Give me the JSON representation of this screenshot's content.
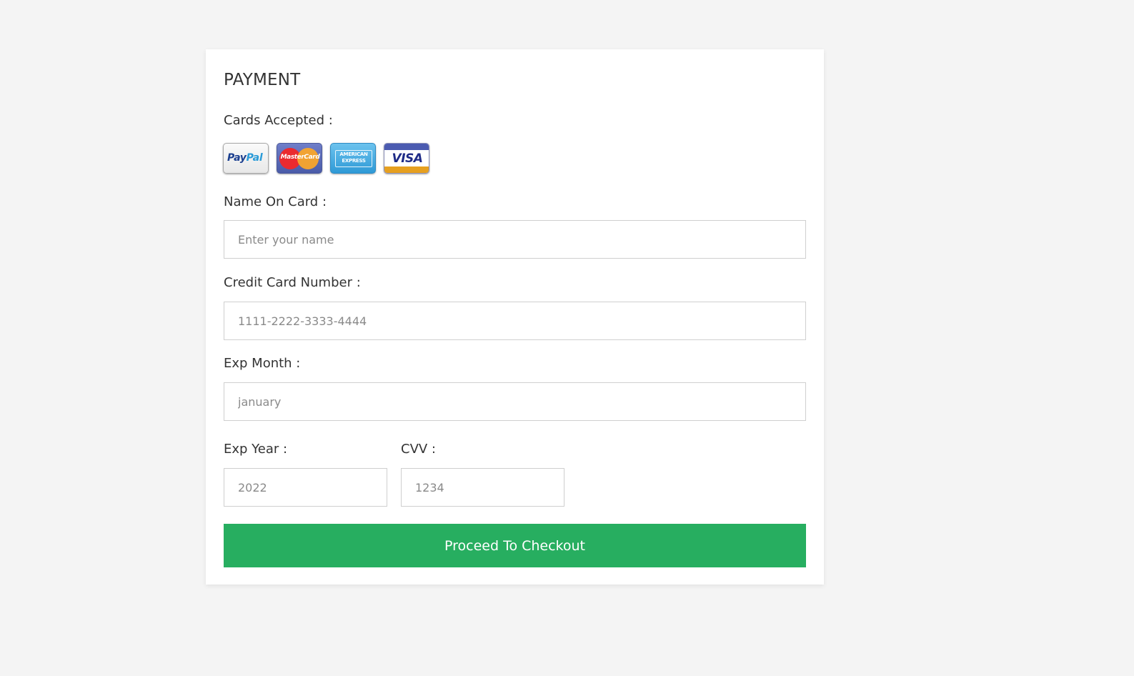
{
  "payment": {
    "title": "PAYMENT",
    "cards_label": "Cards Accepted :",
    "cards": [
      {
        "name": "PayPal",
        "icon": "paypal-icon"
      },
      {
        "name": "MasterCard",
        "icon": "mastercard-icon"
      },
      {
        "name": "AMERICAN EXPRESS",
        "icon": "amex-icon"
      },
      {
        "name": "VISA",
        "icon": "visa-icon"
      }
    ],
    "name_label": "Name On Card :",
    "name_placeholder": "Enter your name",
    "card_number_label": "Credit Card Number :",
    "card_number_placeholder": "1111-2222-3333-4444",
    "exp_month_label": "Exp Month :",
    "exp_month_placeholder": "january",
    "exp_year_label": "Exp Year :",
    "exp_year_placeholder": "2022",
    "cvv_label": "CVV :",
    "cvv_placeholder": "1234",
    "submit_label": "Proceed To Checkout"
  },
  "colors": {
    "page_background": "#f4f4f4",
    "card_background": "#ffffff",
    "button": "#27ae60",
    "button_text": "#ffffff"
  }
}
